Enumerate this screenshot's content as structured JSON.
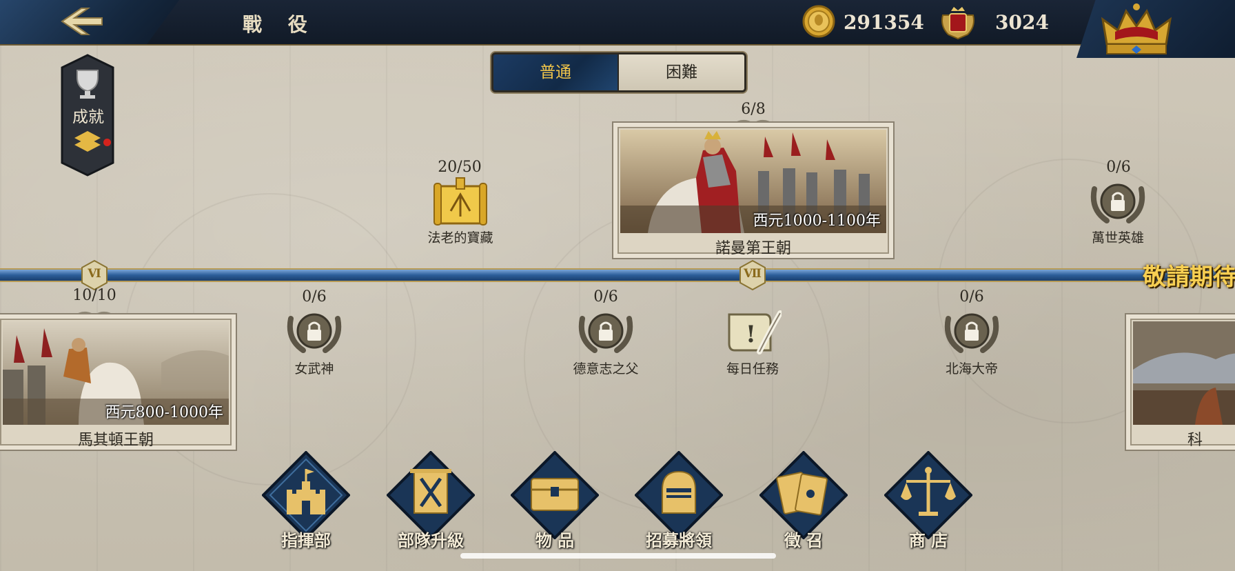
{
  "header": {
    "title": "戰 役",
    "gold_amount": "291354",
    "medal_amount": "3024",
    "back_icon": "back-arrow-icon",
    "crown_icon": "crown-icon"
  },
  "sidebar": {
    "achievements_label": "成就",
    "has_notification": true
  },
  "difficulty": {
    "normal_label": "普通",
    "hard_label": "困難",
    "selected": "normal"
  },
  "timeline": {
    "era_markers": [
      "Ⅵ",
      "Ⅶ"
    ],
    "coming_soon": "敬請期待"
  },
  "campaigns": [
    {
      "title": "馬其頓王朝",
      "date": "西元800-1000年",
      "progress": "10/10"
    },
    {
      "title": "諾曼第王朝",
      "date": "西元1000-1100年",
      "progress": "6/8"
    },
    {
      "title": "科",
      "date": "",
      "progress": ""
    }
  ],
  "nodes": [
    {
      "label": "法老的寶藏",
      "progress": "20/50",
      "icon": "treasure-scroll-icon",
      "locked": false
    },
    {
      "label": "萬世英雄",
      "progress": "0/6",
      "icon": "locked-laurel-icon",
      "locked": true
    },
    {
      "label": "女武神",
      "progress": "0/6",
      "icon": "locked-laurel-icon",
      "locked": true
    },
    {
      "label": "德意志之父",
      "progress": "0/6",
      "icon": "locked-laurel-icon",
      "locked": true
    },
    {
      "label": "每日任務",
      "progress": "",
      "icon": "quest-scroll-icon",
      "locked": false
    },
    {
      "label": "北海大帝",
      "progress": "0/6",
      "icon": "locked-laurel-icon",
      "locked": true
    }
  ],
  "bottom_menu": [
    {
      "label": "指揮部",
      "icon": "castle-icon"
    },
    {
      "label": "部隊升級",
      "icon": "crossed-swords-icon"
    },
    {
      "label": "物 品",
      "icon": "chest-icon"
    },
    {
      "label": "招募將領",
      "icon": "knight-helmet-icon"
    },
    {
      "label": "徵 召",
      "icon": "cards-icon"
    },
    {
      "label": "商 店",
      "icon": "scales-icon"
    }
  ],
  "colors": {
    "accent_gold": "#f2c64a",
    "timeline_blue": "#2c5e99",
    "topbar": "#111a27",
    "parchment": "#c9c2b3"
  }
}
